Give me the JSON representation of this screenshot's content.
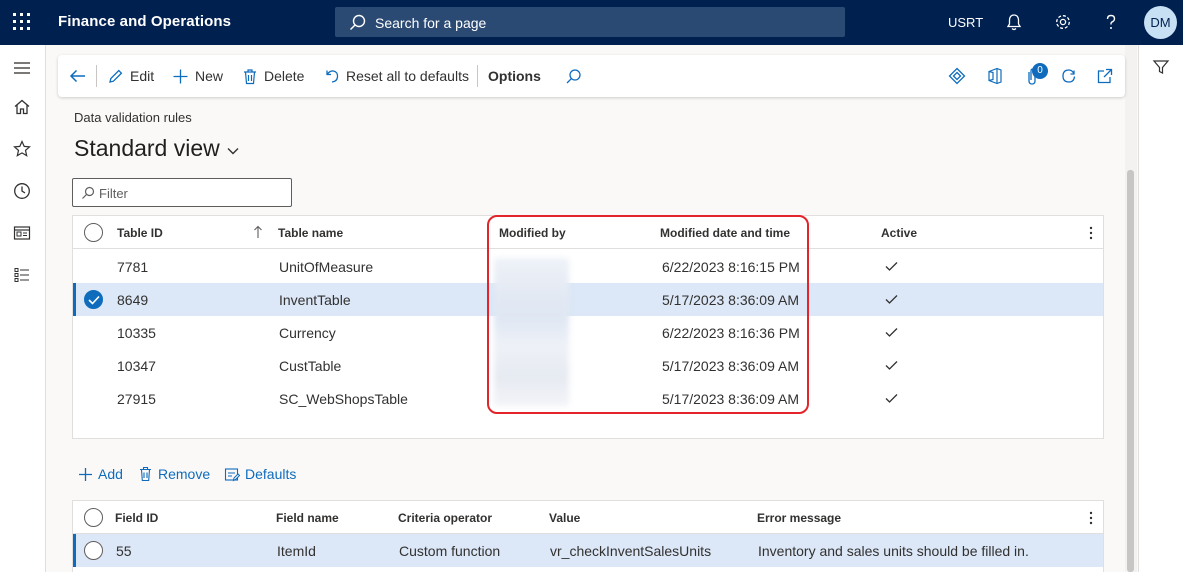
{
  "topbar": {
    "app_title": "Finance and Operations",
    "search_placeholder": "Search for a page",
    "company": "USRT",
    "avatar_initials": "DM"
  },
  "action_pane": {
    "edit": "Edit",
    "new": "New",
    "delete": "Delete",
    "reset": "Reset all to defaults",
    "options": "Options",
    "badge_count": "0"
  },
  "page": {
    "breadcrumb": "Data validation rules",
    "view_title": "Standard view",
    "filter_placeholder": "Filter"
  },
  "rules_grid": {
    "headers": [
      "Table ID",
      "Table name",
      "Modified by",
      "Modified date and time",
      "Active"
    ],
    "rows": [
      {
        "table_id": "7781",
        "table_name": "UnitOfMeasure",
        "modified_by": "",
        "modified": "6/22/2023 8:16:15 PM",
        "active": true,
        "selected": false
      },
      {
        "table_id": "8649",
        "table_name": "InventTable",
        "modified_by": "",
        "modified": "5/17/2023 8:36:09 AM",
        "active": true,
        "selected": true
      },
      {
        "table_id": "10335",
        "table_name": "Currency",
        "modified_by": "",
        "modified": "6/22/2023 8:16:36 PM",
        "active": true,
        "selected": false
      },
      {
        "table_id": "10347",
        "table_name": "CustTable",
        "modified_by": "",
        "modified": "5/17/2023 8:36:09 AM",
        "active": true,
        "selected": false
      },
      {
        "table_id": "27915",
        "table_name": "SC_WebShopsTable",
        "modified_by": "",
        "modified": "5/17/2023 8:36:09 AM",
        "active": true,
        "selected": false
      }
    ]
  },
  "lines_actions": {
    "add": "Add",
    "remove": "Remove",
    "defaults": "Defaults"
  },
  "lines_grid": {
    "headers": [
      "Field ID",
      "Field name",
      "Criteria operator",
      "Value",
      "Error message"
    ],
    "rows": [
      {
        "field_id": "55",
        "field_name": "ItemId",
        "operator": "Custom function",
        "value": "vr_checkInventSalesUnits",
        "error": "Inventory and sales units should be filled in."
      }
    ]
  },
  "colors": {
    "topbar": "#002050",
    "accent": "#0f6cbd",
    "selected_row": "#dce7f7",
    "highlight": "#e3242b"
  }
}
